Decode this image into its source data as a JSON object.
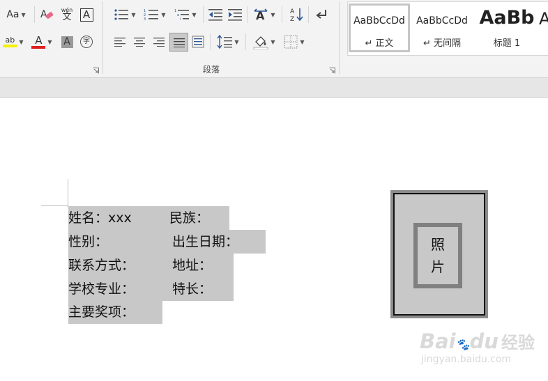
{
  "ribbon": {
    "font_group": {
      "change_case_label": "Aa",
      "phonetic_guide_label": "wén",
      "phonetic_guide_char": "文",
      "char_border_label": "A",
      "highlight_label": "ab",
      "font_color_label": "A",
      "char_shading_label": "A",
      "enclose_char_label": "字",
      "highlight_color": "#f6f100",
      "font_color": "#e02020"
    },
    "paragraph_group": {
      "label": "段落",
      "sort_label": "A↓Z"
    },
    "styles_group": {
      "items": [
        {
          "sample": "AaBbCcDd",
          "name": "↵ 正文",
          "selected": true
        },
        {
          "sample": "AaBbCcDd",
          "name": "↵ 无间隔",
          "selected": false
        },
        {
          "sample": "AaBb",
          "name": "标题 1",
          "selected": false
        },
        {
          "sample": "A",
          "name": "",
          "selected": false
        }
      ]
    }
  },
  "document": {
    "lines": [
      {
        "left": "姓名：xxx",
        "right": "民族："
      },
      {
        "left": "性别：",
        "right": "出生日期："
      },
      {
        "left": "联系方式：",
        "right": "地址："
      },
      {
        "left": "学校专业：",
        "right": "特长："
      },
      {
        "left": "主要奖项：",
        "right": ""
      }
    ],
    "photo": {
      "line1": "照",
      "line2": "片"
    }
  },
  "watermark": {
    "logo": "Bai",
    "paw": "du",
    "brand": "经验",
    "url": "jingyan.baidu.com"
  }
}
